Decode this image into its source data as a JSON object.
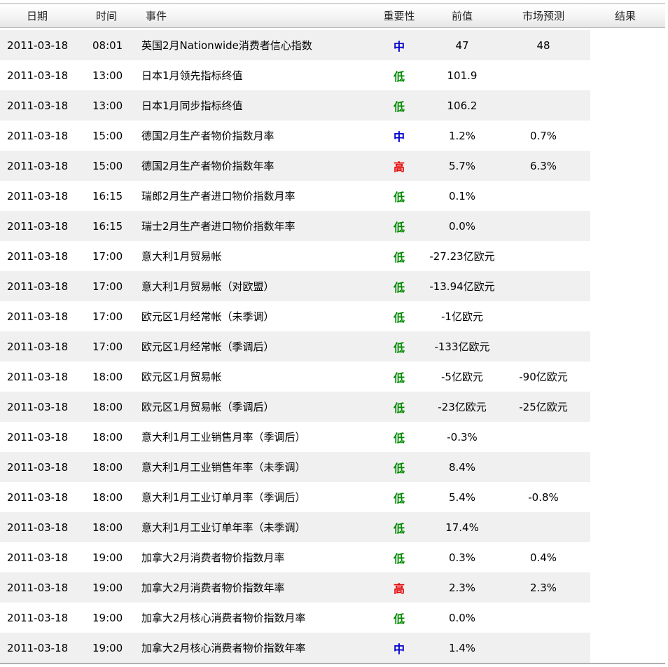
{
  "header": {
    "date": "日期",
    "time": "时间",
    "event": "事件",
    "importance": "重要性",
    "previous": "前值",
    "forecast": "市场预测",
    "result": "结果"
  },
  "importance_colors": {
    "高": "#e60000",
    "中": "#0000cc",
    "低": "#008a00"
  },
  "rows": [
    {
      "date": "2011-03-18",
      "time": "08:01",
      "event": "英国2月Nationwide消费者信心指数",
      "importance": "中",
      "previous": "47",
      "forecast": "48",
      "result": ""
    },
    {
      "date": "2011-03-18",
      "time": "13:00",
      "event": "日本1月领先指标终值",
      "importance": "低",
      "previous": "101.9",
      "forecast": "",
      "result": ""
    },
    {
      "date": "2011-03-18",
      "time": "13:00",
      "event": "日本1月同步指标终值",
      "importance": "低",
      "previous": "106.2",
      "forecast": "",
      "result": ""
    },
    {
      "date": "2011-03-18",
      "time": "15:00",
      "event": "德国2月生产者物价指数月率",
      "importance": "中",
      "previous": "1.2%",
      "forecast": "0.7%",
      "result": ""
    },
    {
      "date": "2011-03-18",
      "time": "15:00",
      "event": "德国2月生产者物价指数年率",
      "importance": "高",
      "previous": "5.7%",
      "forecast": "6.3%",
      "result": ""
    },
    {
      "date": "2011-03-18",
      "time": "16:15",
      "event": "瑞郎2月生产者进口物价指数月率",
      "importance": "低",
      "previous": "0.1%",
      "forecast": "",
      "result": ""
    },
    {
      "date": "2011-03-18",
      "time": "16:15",
      "event": "瑞士2月生产者进口物价指数年率",
      "importance": "低",
      "previous": "0.0%",
      "forecast": "",
      "result": ""
    },
    {
      "date": "2011-03-18",
      "time": "17:00",
      "event": "意大利1月贸易帐",
      "importance": "低",
      "previous": "-27.23亿欧元",
      "forecast": "",
      "result": ""
    },
    {
      "date": "2011-03-18",
      "time": "17:00",
      "event": "意大利1月贸易帐（对欧盟）",
      "importance": "低",
      "previous": "-13.94亿欧元",
      "forecast": "",
      "result": ""
    },
    {
      "date": "2011-03-18",
      "time": "17:00",
      "event": "欧元区1月经常帐（未季调）",
      "importance": "低",
      "previous": "-1亿欧元",
      "forecast": "",
      "result": ""
    },
    {
      "date": "2011-03-18",
      "time": "17:00",
      "event": "欧元区1月经常帐（季调后）",
      "importance": "低",
      "previous": "-133亿欧元",
      "forecast": "",
      "result": ""
    },
    {
      "date": "2011-03-18",
      "time": "18:00",
      "event": "欧元区1月贸易帐",
      "importance": "低",
      "previous": "-5亿欧元",
      "forecast": "-90亿欧元",
      "result": ""
    },
    {
      "date": "2011-03-18",
      "time": "18:00",
      "event": "欧元区1月贸易帐（季调后）",
      "importance": "低",
      "previous": "-23亿欧元",
      "forecast": "-25亿欧元",
      "result": ""
    },
    {
      "date": "2011-03-18",
      "time": "18:00",
      "event": "意大利1月工业销售月率（季调后）",
      "importance": "低",
      "previous": "-0.3%",
      "forecast": "",
      "result": ""
    },
    {
      "date": "2011-03-18",
      "time": "18:00",
      "event": "意大利1月工业销售年率（未季调）",
      "importance": "低",
      "previous": "8.4%",
      "forecast": "",
      "result": ""
    },
    {
      "date": "2011-03-18",
      "time": "18:00",
      "event": "意大利1月工业订单月率（季调后）",
      "importance": "低",
      "previous": "5.4%",
      "forecast": "-0.8%",
      "result": ""
    },
    {
      "date": "2011-03-18",
      "time": "18:00",
      "event": "意大利1月工业订单年率（未季调）",
      "importance": "低",
      "previous": "17.4%",
      "forecast": "",
      "result": ""
    },
    {
      "date": "2011-03-18",
      "time": "19:00",
      "event": "加拿大2月消费者物价指数月率",
      "importance": "低",
      "previous": "0.3%",
      "forecast": "0.4%",
      "result": ""
    },
    {
      "date": "2011-03-18",
      "time": "19:00",
      "event": "加拿大2月消费者物价指数年率",
      "importance": "高",
      "previous": "2.3%",
      "forecast": "2.3%",
      "result": ""
    },
    {
      "date": "2011-03-18",
      "time": "19:00",
      "event": "加拿大2月核心消费者物价指数月率",
      "importance": "低",
      "previous": "0.0%",
      "forecast": "",
      "result": ""
    },
    {
      "date": "2011-03-18",
      "time": "19:00",
      "event": "加拿大2月核心消费者物价指数年率",
      "importance": "中",
      "previous": "1.4%",
      "forecast": "",
      "result": ""
    }
  ]
}
